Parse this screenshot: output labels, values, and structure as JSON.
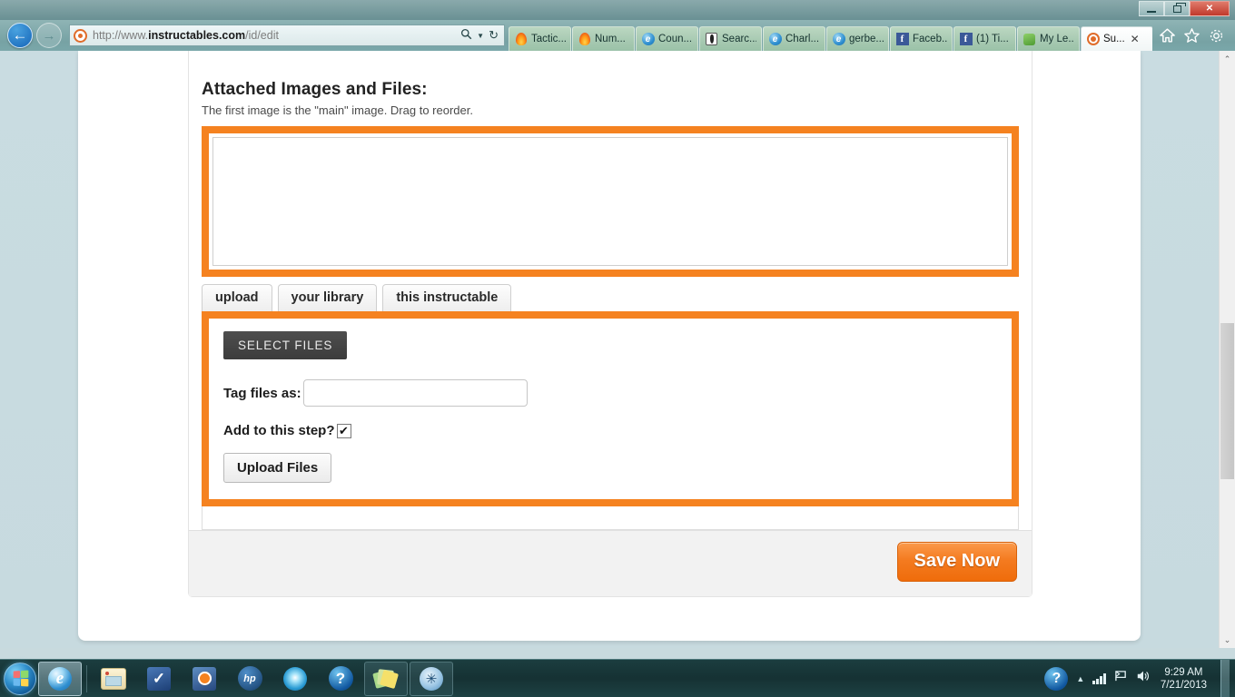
{
  "window": {
    "minimize_label": "Minimize",
    "restore_label": "Restore",
    "close_label": "✕"
  },
  "browser": {
    "back_label": "←",
    "forward_label": "→",
    "address": {
      "prefix": "http://www.",
      "domain": "instructables.com",
      "path": "/id/edit",
      "search_icon": "search-icon",
      "refresh_icon": "↻",
      "dropdown_caret": "▼"
    },
    "tabs": [
      {
        "label": "Tactic...",
        "icon": "flame-icon",
        "active": false
      },
      {
        "label": "Num...",
        "icon": "flame-icon",
        "active": false
      },
      {
        "label": "Coun...",
        "icon": "ie-icon",
        "active": false
      },
      {
        "label": "Searc...",
        "icon": "black-pen-icon",
        "active": false
      },
      {
        "label": "Charl...",
        "icon": "ie-icon",
        "active": false
      },
      {
        "label": "gerbe...",
        "icon": "ie-icon",
        "active": false
      },
      {
        "label": "Faceb...",
        "icon": "facebook-icon",
        "active": false
      },
      {
        "label": "(1) Ti...",
        "icon": "facebook-icon",
        "active": false
      },
      {
        "label": "My Le...",
        "icon": "green-square-icon",
        "active": false
      },
      {
        "label": "Su...",
        "icon": "instructables-icon",
        "active": true,
        "close": "✕"
      }
    ],
    "toolbar_icons": [
      "home-icon",
      "favorites-star-icon",
      "settings-gear-icon"
    ]
  },
  "page": {
    "heading": "Attached Images and Files:",
    "subheading": "The first image is the \"main\" image. Drag to reorder.",
    "dropzone_placeholder": "",
    "tabs": [
      {
        "label": "upload"
      },
      {
        "label": "your library"
      },
      {
        "label": "this instructable"
      }
    ],
    "upload_panel": {
      "select_files_label": "SELECT FILES",
      "tag_label": "Tag files as:",
      "tag_value": "",
      "tag_placeholder": "",
      "add_to_step_label": "Add to this step?",
      "add_to_step_checked": true,
      "checkbox_glyph": "✔",
      "upload_button_label": "Upload Files"
    },
    "save_button_label": "Save Now"
  },
  "scrollbar": {
    "up_arrow": "⌃",
    "down_arrow": "⌄"
  },
  "desktop": {
    "icon_name": "fingerprint-password-manager-icon"
  },
  "taskbar": {
    "start_label": "Start",
    "items": [
      {
        "name": "internet-explorer",
        "icon": "ie-icon"
      },
      {
        "name": "windows-explorer",
        "icon": "folder-icon"
      },
      {
        "name": "checkmark-app",
        "icon": "check-icon"
      },
      {
        "name": "media-player",
        "icon": "media-play-icon"
      },
      {
        "name": "hp-support",
        "icon": "hp-icon"
      },
      {
        "name": "glow-app",
        "icon": "glow-orb-icon"
      },
      {
        "name": "help",
        "icon": "question-mark-icon"
      },
      {
        "name": "sticky-notes",
        "icon": "sticky-notes-icon"
      },
      {
        "name": "satellite-app",
        "icon": "satellite-icon"
      }
    ],
    "tray": {
      "overflow_caret": "▲",
      "network_icon": "signal-bars-icon",
      "action_center_icon": "flag-icon",
      "volume_icon": "speaker-icon",
      "time": "9:29 AM",
      "date": "7/21/2013"
    }
  },
  "colors": {
    "accent_orange": "#f58220",
    "save_button": "#f47b20",
    "taskbar": "#163a3c"
  }
}
